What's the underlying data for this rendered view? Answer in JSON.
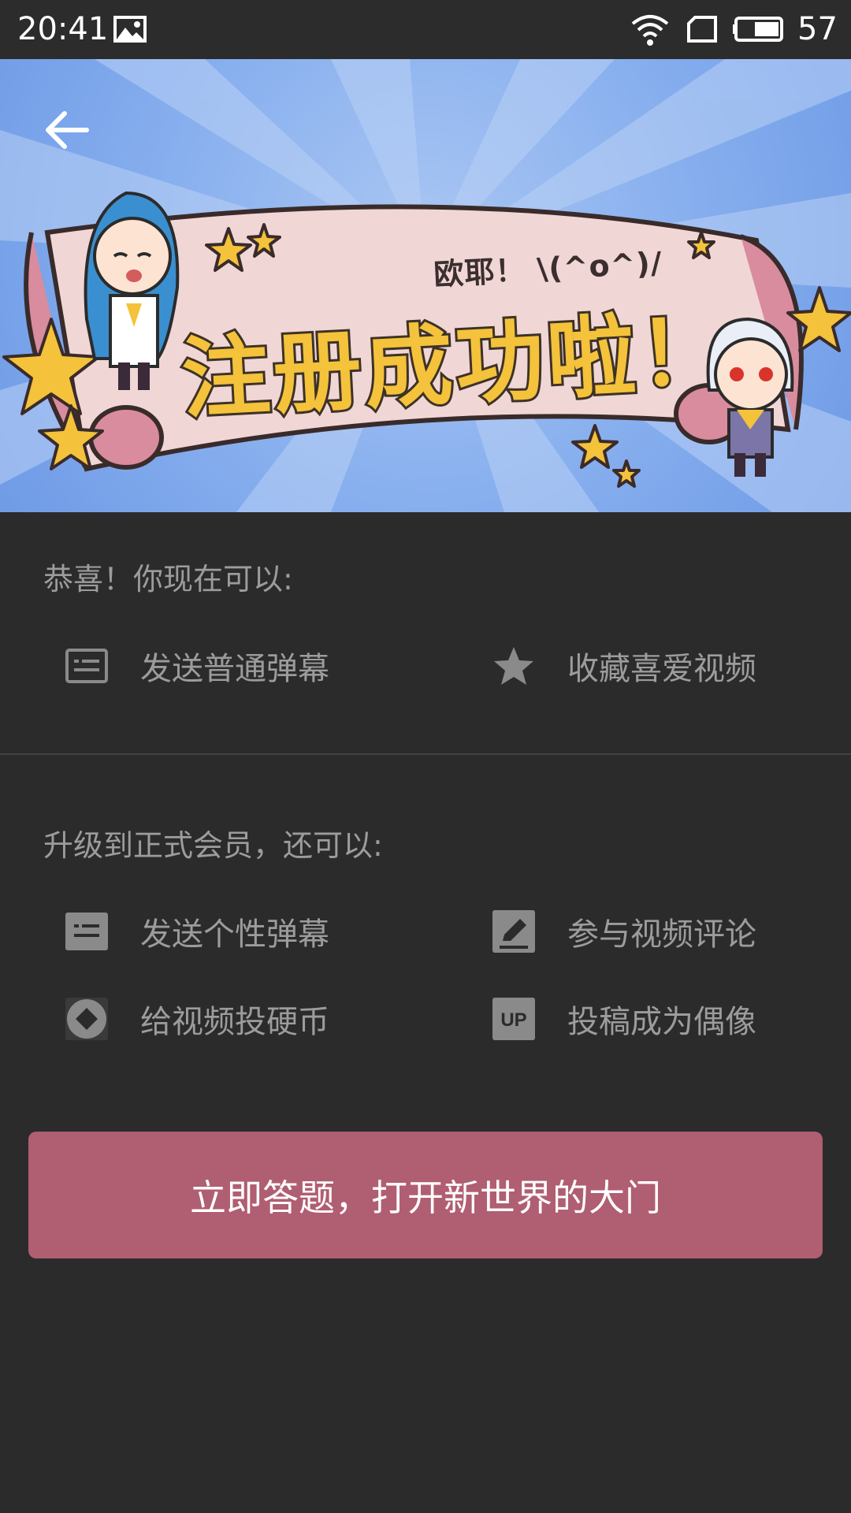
{
  "status_bar": {
    "time": "20:41",
    "battery_level": "57",
    "icons": [
      "gallery-icon",
      "wifi-icon",
      "sim-card-icon",
      "battery-icon"
    ]
  },
  "banner": {
    "greeting": "欧耶！ \\(^o^)/",
    "title": "注册成功啦！",
    "back_icon": "arrow-left-icon"
  },
  "section_current": {
    "heading": "恭喜！你现在可以:",
    "features": [
      {
        "label": "发送普通弹幕",
        "icon": "danmaku-icon"
      },
      {
        "label": "收藏喜爱视频",
        "icon": "star-icon"
      }
    ]
  },
  "section_upgrade": {
    "heading": "升级到正式会员，还可以:",
    "features": [
      {
        "label": "发送个性弹幕",
        "icon": "styled-danmaku-icon"
      },
      {
        "label": "参与视频评论",
        "icon": "pencil-icon"
      },
      {
        "label": "给视频投硬币",
        "icon": "coin-icon"
      },
      {
        "label": "投稿成为偶像",
        "icon": "up-icon"
      }
    ]
  },
  "cta": {
    "label": "立即答题，打开新世界的大门"
  },
  "colors": {
    "background": "#2b2b2b",
    "accent_button": "#b05e72",
    "muted_text": "#9c9c9c",
    "banner_sky": "#86aeee",
    "title_yellow": "#f4c23b"
  }
}
